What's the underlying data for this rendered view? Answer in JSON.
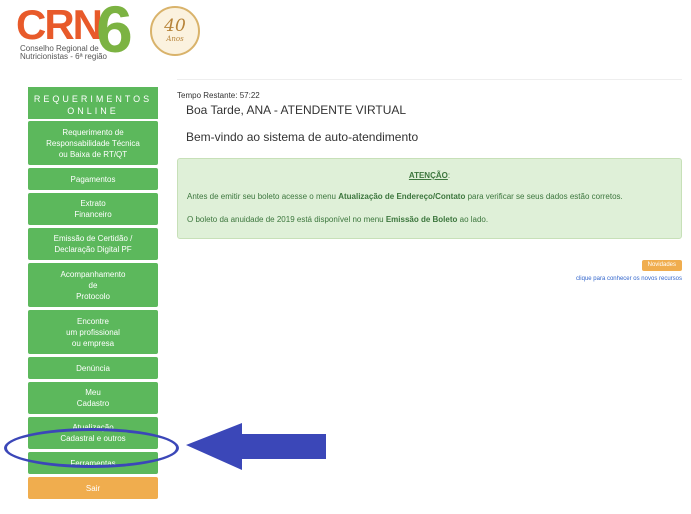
{
  "logo": {
    "crn": "CRN",
    "number": "6",
    "subtitle_line1": "Conselho Regional de",
    "subtitle_line2": "Nutricionistas - 6ª região",
    "seal_number": "40",
    "seal_text": "Anos"
  },
  "sidebar": {
    "title_line1": "REQUERIMENTOS",
    "title_line2": "ONLINE",
    "items": [
      {
        "lines": [
          "Requerimento de",
          "Responsabilidade Técnica",
          "ou Baixa de RT/QT"
        ]
      },
      {
        "lines": [
          "Pagamentos"
        ]
      },
      {
        "lines": [
          "Extrato",
          "Financeiro"
        ]
      },
      {
        "lines": [
          "Emissão de Certidão /",
          "Declaração Digital PF"
        ]
      },
      {
        "lines": [
          "Acompanhamento",
          "de",
          "Protocolo"
        ]
      },
      {
        "lines": [
          "Encontre",
          "um profissional",
          "ou empresa"
        ]
      },
      {
        "lines": [
          "Denúncia"
        ]
      },
      {
        "lines": [
          "Meu",
          "Cadastro"
        ]
      },
      {
        "lines": [
          "Atualização",
          "Cadastral e outros"
        ]
      },
      {
        "lines": [
          "Ferramentas"
        ]
      },
      {
        "lines": [
          "Sair"
        ]
      }
    ]
  },
  "content": {
    "timer": "Tempo Restante: 57:22",
    "greeting": "Boa Tarde, ANA - ATENDENTE VIRTUAL",
    "welcome": "Bem-vindo ao sistema de auto-atendimento",
    "alert": {
      "title": "ATENÇÃO",
      "title_suffix": ":",
      "line1_a": "Antes de emitir seu boleto acesse o menu ",
      "line1_b": "Atualização de Endereço/Contato",
      "line1_c": " para verificar se seus dados estão corretos.",
      "line2_a": "O boleto da anuidade de 2019 está disponível no menu ",
      "line2_b": "Emissão de Boleto",
      "line2_c": " ao lado."
    },
    "novidades_button": "Novidades",
    "novidades_link": "clique para conhecer os novos recursos"
  },
  "colors": {
    "menu_green": "#5cb85c",
    "sair_orange": "#f0ad4e",
    "annotation_blue": "#3b47b8",
    "alert_bg": "#dff0d8"
  }
}
